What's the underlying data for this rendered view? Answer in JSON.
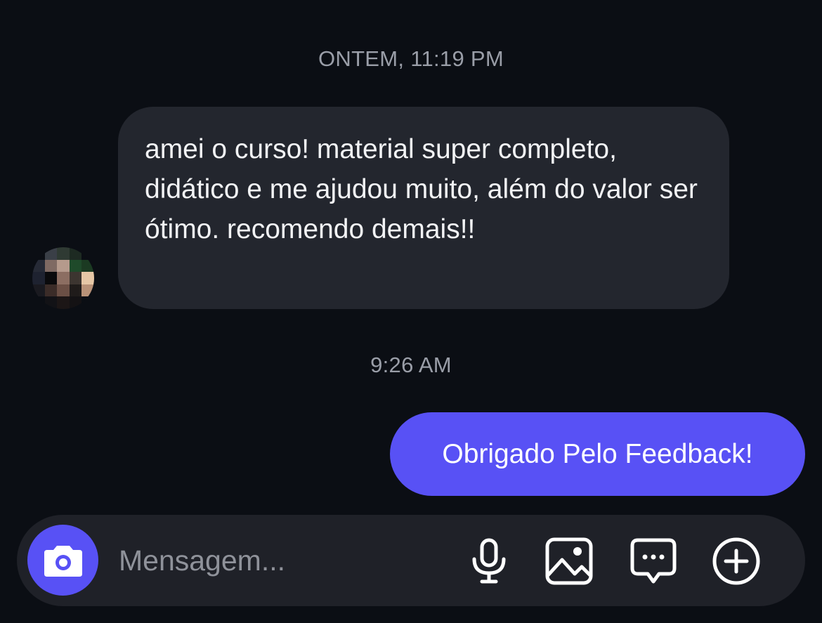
{
  "conversation": {
    "timestamp_yesterday": "ONTEM, 11:19 PM",
    "timestamp_today": "9:26 AM",
    "incoming_message": "amei o curso! material super completo, didático e me ajudou muito, além do valor ser ótimo. recomendo demais!!",
    "outgoing_message": "Obrigado Pelo Feedback!"
  },
  "composer": {
    "placeholder": "Mensagem...",
    "value": ""
  },
  "icons": {
    "camera": "camera-icon",
    "microphone": "microphone-icon",
    "gallery": "gallery-icon",
    "sticker": "chat-bubble-icon",
    "more": "plus-circle-icon"
  },
  "colors": {
    "background": "#0b0e14",
    "incoming_bubble": "#23262e",
    "outgoing_bubble": "#5851f5",
    "accent": "#5851f5",
    "composer_bg": "#1f2128",
    "timestamp_text": "#9a9ea8"
  }
}
